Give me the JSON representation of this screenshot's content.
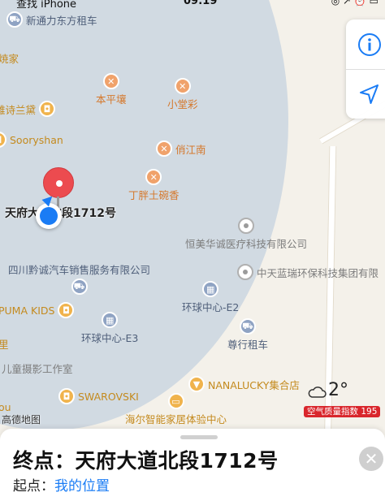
{
  "status_bar": {
    "carrier": "查找 iPhone",
    "time": "09:19",
    "right_icons": "◎ ↗ ⏰ ▭"
  },
  "map": {
    "destination_label": "天府大道北段1712号",
    "pois": [
      {
        "name": "新通力东方租车",
        "kind": "transit",
        "icon": "car-icon",
        "glyph": "⛟"
      },
      {
        "name": "本平壤",
        "kind": "food",
        "icon": "fork-knife-icon",
        "glyph": "✕"
      },
      {
        "name": "小堂彩",
        "kind": "food",
        "icon": "fork-knife-icon",
        "glyph": "✕"
      },
      {
        "name": "雅诗兰黛",
        "kind": "shop",
        "icon": "bag-icon",
        "glyph": "◘"
      },
      {
        "name": "Sooryshan",
        "kind": "shop",
        "icon": "bag-icon",
        "glyph": "◘"
      },
      {
        "name": "俏江南",
        "kind": "food",
        "icon": "fork-knife-icon",
        "glyph": "✕"
      },
      {
        "name": "丁胖土碗香",
        "kind": "food",
        "icon": "fork-knife-icon",
        "glyph": "✕"
      },
      {
        "name": "恒美华诚医疗科技有限公司",
        "kind": "gray",
        "icon": "place-icon",
        "glyph": ""
      },
      {
        "name": "四川黔诚汽车销售服务有限公司",
        "kind": "transit",
        "icon": "car-icon",
        "glyph": "⛟"
      },
      {
        "name": "中天蓝瑞环保科技集团有限",
        "kind": "gray",
        "icon": "place-icon",
        "glyph": ""
      },
      {
        "name": "PUMA KIDS",
        "kind": "shop",
        "icon": "bag-icon",
        "glyph": "◘"
      },
      {
        "name": "环球中心-E2",
        "kind": "transit",
        "icon": "building-icon",
        "glyph": "▦"
      },
      {
        "name": "环球中心-E3",
        "kind": "transit",
        "icon": "building-icon",
        "glyph": "▦"
      },
      {
        "name": "尊行租车",
        "kind": "transit",
        "icon": "car-icon",
        "glyph": "⛟"
      },
      {
        "name": "NANALUCKY集合店",
        "kind": "shop",
        "icon": "shirt-icon",
        "glyph": "▼"
      },
      {
        "name": "SWAROVSKI",
        "kind": "shop",
        "icon": "bag-icon",
        "glyph": "◘"
      },
      {
        "name": "海尔智能家居体验中心",
        "kind": "shop",
        "icon": "tv-icon",
        "glyph": "▭"
      }
    ],
    "edge_labels": [
      "焼家",
      "儿童摄影工作室",
      "ou",
      "里"
    ]
  },
  "weather": {
    "temperature": "2°",
    "aqi_label": "空气质量指数 195",
    "icon": "cloud-icon"
  },
  "logo": "高德地图",
  "sheet": {
    "destination": "终点：天府大道北段1712号",
    "origin_prefix": "起点：",
    "origin_value": "我的位置"
  },
  "colors": {
    "accent": "#1a7cf5",
    "pin": "#ec4b4f",
    "aqi": "#d9262c"
  }
}
